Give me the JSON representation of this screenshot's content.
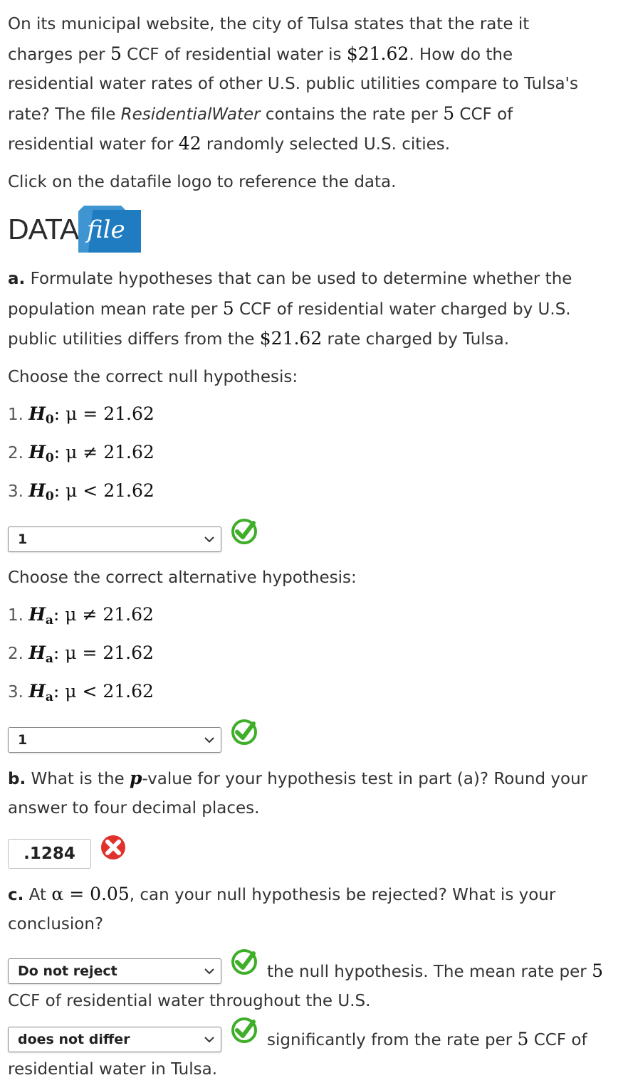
{
  "intro": {
    "l1": "On its municipal website, the city of Tulsa states that the rate it",
    "l2a": "charges per ",
    "l2n": "5",
    "l2b": " CCF of residential water is ",
    "l2m": "$21.62",
    "l2c": ". How do the",
    "l3": "residential water rates of other U.S. public utilities compare to Tulsa's",
    "l4a": "rate? The file ",
    "l4f": "ResidentialWater",
    "l4b": " contains the rate per ",
    "l4n": "5",
    "l4c": " CCF of",
    "l5a": "residential water for ",
    "l5n": "42",
    "l5b": " randomly selected U.S. cities.",
    "click": "Click on the datafile logo to reference the data."
  },
  "logo": {
    "data": "DATA",
    "file": "file"
  },
  "part_a": {
    "label": "a.",
    "l1": " Formulate hypotheses that can be used to determine whether the",
    "l2a": "population mean rate per ",
    "l2n": "5",
    "l2b": " CCF of residential water charged by U.S.",
    "l3a": "public utilities differs from the ",
    "l3m": "$21.62",
    "l3b": " rate charged by Tulsa.",
    "null_prompt": "Choose the correct null hypothesis:",
    "null_options": [
      {
        "num": "1. ",
        "h": "H",
        "s": "0",
        "rel": ": μ = 21.62"
      },
      {
        "num": "2. ",
        "h": "H",
        "s": "0",
        "rel": ": μ ≠ 21.62"
      },
      {
        "num": "3. ",
        "h": "H",
        "s": "0",
        "rel": ": μ < 21.62"
      }
    ],
    "null_selected": "1",
    "alt_prompt": "Choose the correct alternative hypothesis:",
    "alt_options": [
      {
        "num": "1. ",
        "h": "H",
        "s": "a",
        "rel": ": μ ≠ 21.62"
      },
      {
        "num": "2. ",
        "h": "H",
        "s": "a",
        "rel": ": μ = 21.62"
      },
      {
        "num": "3. ",
        "h": "H",
        "s": "a",
        "rel": ": μ < 21.62"
      }
    ],
    "alt_selected": "1"
  },
  "part_b": {
    "label": "b.",
    "l1a": " What is the ",
    "l1p": "p",
    "l1b": "-value for your hypothesis test in part (a)? Round your",
    "l2": "answer to four decimal places.",
    "answer": ".1284"
  },
  "part_c": {
    "label": "c.",
    "l1a": " At ",
    "l1m": "α = 0.05",
    "l1b": ", can your null hypothesis be rejected? What is your",
    "l2": "conclusion?",
    "select1": "Do not reject",
    "after1a": "the null hypothesis. The mean rate per ",
    "after1n": "5",
    "mid": "CCF of residential water throughout the U.S.",
    "select2": "does not differ",
    "after2a": "significantly from the rate per ",
    "after2n": "5",
    "after2b": " CCF of",
    "end": "residential water in Tulsa."
  },
  "colors": {
    "check_green": "#3fae29",
    "x_red": "#e0312c",
    "logo_blue": "#1f7cc1"
  },
  "icons": [
    "check-icon",
    "x-icon",
    "chevron-down-icon"
  ]
}
